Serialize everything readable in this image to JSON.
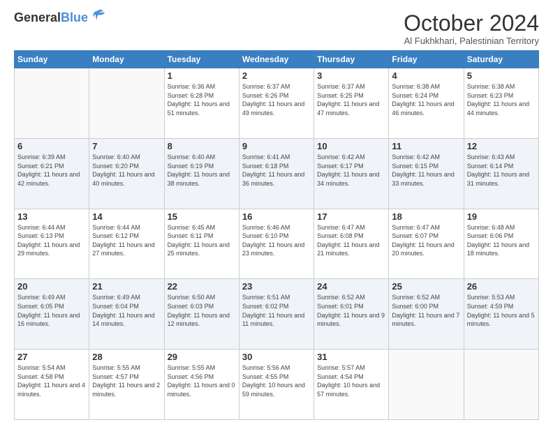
{
  "header": {
    "logo_line1": "General",
    "logo_line2": "Blue",
    "month": "October 2024",
    "location": "Al Fukhkhari, Palestinian Territory"
  },
  "weekdays": [
    "Sunday",
    "Monday",
    "Tuesday",
    "Wednesday",
    "Thursday",
    "Friday",
    "Saturday"
  ],
  "weeks": [
    [
      {
        "day": "",
        "sunrise": "",
        "sunset": "",
        "daylight": ""
      },
      {
        "day": "",
        "sunrise": "",
        "sunset": "",
        "daylight": ""
      },
      {
        "day": "1",
        "sunrise": "Sunrise: 6:36 AM",
        "sunset": "Sunset: 6:28 PM",
        "daylight": "Daylight: 11 hours and 51 minutes."
      },
      {
        "day": "2",
        "sunrise": "Sunrise: 6:37 AM",
        "sunset": "Sunset: 6:26 PM",
        "daylight": "Daylight: 11 hours and 49 minutes."
      },
      {
        "day": "3",
        "sunrise": "Sunrise: 6:37 AM",
        "sunset": "Sunset: 6:25 PM",
        "daylight": "Daylight: 11 hours and 47 minutes."
      },
      {
        "day": "4",
        "sunrise": "Sunrise: 6:38 AM",
        "sunset": "Sunset: 6:24 PM",
        "daylight": "Daylight: 11 hours and 46 minutes."
      },
      {
        "day": "5",
        "sunrise": "Sunrise: 6:38 AM",
        "sunset": "Sunset: 6:23 PM",
        "daylight": "Daylight: 11 hours and 44 minutes."
      }
    ],
    [
      {
        "day": "6",
        "sunrise": "Sunrise: 6:39 AM",
        "sunset": "Sunset: 6:21 PM",
        "daylight": "Daylight: 11 hours and 42 minutes."
      },
      {
        "day": "7",
        "sunrise": "Sunrise: 6:40 AM",
        "sunset": "Sunset: 6:20 PM",
        "daylight": "Daylight: 11 hours and 40 minutes."
      },
      {
        "day": "8",
        "sunrise": "Sunrise: 6:40 AM",
        "sunset": "Sunset: 6:19 PM",
        "daylight": "Daylight: 11 hours and 38 minutes."
      },
      {
        "day": "9",
        "sunrise": "Sunrise: 6:41 AM",
        "sunset": "Sunset: 6:18 PM",
        "daylight": "Daylight: 11 hours and 36 minutes."
      },
      {
        "day": "10",
        "sunrise": "Sunrise: 6:42 AM",
        "sunset": "Sunset: 6:17 PM",
        "daylight": "Daylight: 11 hours and 34 minutes."
      },
      {
        "day": "11",
        "sunrise": "Sunrise: 6:42 AM",
        "sunset": "Sunset: 6:15 PM",
        "daylight": "Daylight: 11 hours and 33 minutes."
      },
      {
        "day": "12",
        "sunrise": "Sunrise: 6:43 AM",
        "sunset": "Sunset: 6:14 PM",
        "daylight": "Daylight: 11 hours and 31 minutes."
      }
    ],
    [
      {
        "day": "13",
        "sunrise": "Sunrise: 6:44 AM",
        "sunset": "Sunset: 6:13 PM",
        "daylight": "Daylight: 11 hours and 29 minutes."
      },
      {
        "day": "14",
        "sunrise": "Sunrise: 6:44 AM",
        "sunset": "Sunset: 6:12 PM",
        "daylight": "Daylight: 11 hours and 27 minutes."
      },
      {
        "day": "15",
        "sunrise": "Sunrise: 6:45 AM",
        "sunset": "Sunset: 6:11 PM",
        "daylight": "Daylight: 11 hours and 25 minutes."
      },
      {
        "day": "16",
        "sunrise": "Sunrise: 6:46 AM",
        "sunset": "Sunset: 6:10 PM",
        "daylight": "Daylight: 11 hours and 23 minutes."
      },
      {
        "day": "17",
        "sunrise": "Sunrise: 6:47 AM",
        "sunset": "Sunset: 6:08 PM",
        "daylight": "Daylight: 11 hours and 21 minutes."
      },
      {
        "day": "18",
        "sunrise": "Sunrise: 6:47 AM",
        "sunset": "Sunset: 6:07 PM",
        "daylight": "Daylight: 11 hours and 20 minutes."
      },
      {
        "day": "19",
        "sunrise": "Sunrise: 6:48 AM",
        "sunset": "Sunset: 6:06 PM",
        "daylight": "Daylight: 11 hours and 18 minutes."
      }
    ],
    [
      {
        "day": "20",
        "sunrise": "Sunrise: 6:49 AM",
        "sunset": "Sunset: 6:05 PM",
        "daylight": "Daylight: 11 hours and 16 minutes."
      },
      {
        "day": "21",
        "sunrise": "Sunrise: 6:49 AM",
        "sunset": "Sunset: 6:04 PM",
        "daylight": "Daylight: 11 hours and 14 minutes."
      },
      {
        "day": "22",
        "sunrise": "Sunrise: 6:50 AM",
        "sunset": "Sunset: 6:03 PM",
        "daylight": "Daylight: 11 hours and 12 minutes."
      },
      {
        "day": "23",
        "sunrise": "Sunrise: 6:51 AM",
        "sunset": "Sunset: 6:02 PM",
        "daylight": "Daylight: 11 hours and 11 minutes."
      },
      {
        "day": "24",
        "sunrise": "Sunrise: 6:52 AM",
        "sunset": "Sunset: 6:01 PM",
        "daylight": "Daylight: 11 hours and 9 minutes."
      },
      {
        "day": "25",
        "sunrise": "Sunrise: 6:52 AM",
        "sunset": "Sunset: 6:00 PM",
        "daylight": "Daylight: 11 hours and 7 minutes."
      },
      {
        "day": "26",
        "sunrise": "Sunrise: 5:53 AM",
        "sunset": "Sunset: 4:59 PM",
        "daylight": "Daylight: 11 hours and 5 minutes."
      }
    ],
    [
      {
        "day": "27",
        "sunrise": "Sunrise: 5:54 AM",
        "sunset": "Sunset: 4:58 PM",
        "daylight": "Daylight: 11 hours and 4 minutes."
      },
      {
        "day": "28",
        "sunrise": "Sunrise: 5:55 AM",
        "sunset": "Sunset: 4:57 PM",
        "daylight": "Daylight: 11 hours and 2 minutes."
      },
      {
        "day": "29",
        "sunrise": "Sunrise: 5:55 AM",
        "sunset": "Sunset: 4:56 PM",
        "daylight": "Daylight: 11 hours and 0 minutes."
      },
      {
        "day": "30",
        "sunrise": "Sunrise: 5:56 AM",
        "sunset": "Sunset: 4:55 PM",
        "daylight": "Daylight: 10 hours and 59 minutes."
      },
      {
        "day": "31",
        "sunrise": "Sunrise: 5:57 AM",
        "sunset": "Sunset: 4:54 PM",
        "daylight": "Daylight: 10 hours and 57 minutes."
      },
      {
        "day": "",
        "sunrise": "",
        "sunset": "",
        "daylight": ""
      },
      {
        "day": "",
        "sunrise": "",
        "sunset": "",
        "daylight": ""
      }
    ]
  ]
}
